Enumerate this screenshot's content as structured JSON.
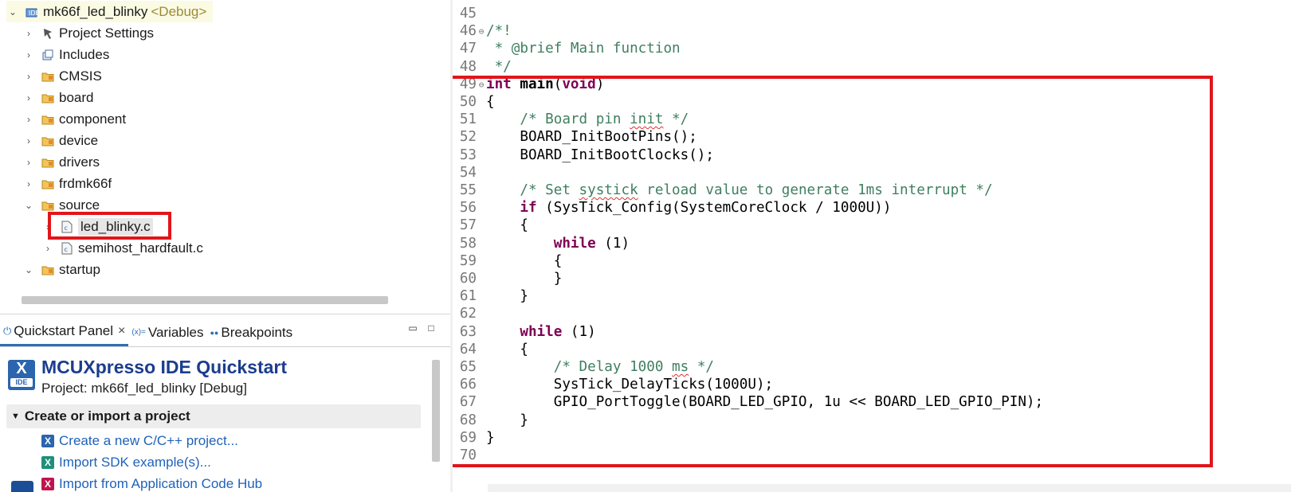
{
  "explorer": {
    "project": {
      "name": "mk66f_led_blinky",
      "decoration": "<Debug>"
    },
    "items": [
      {
        "label": "Project Settings",
        "icon": "settings-icon",
        "expanded": false
      },
      {
        "label": "Includes",
        "icon": "includes-icon",
        "expanded": false
      },
      {
        "label": "CMSIS",
        "icon": "folder-icon",
        "expanded": false
      },
      {
        "label": "board",
        "icon": "folder-icon",
        "expanded": false
      },
      {
        "label": "component",
        "icon": "folder-icon",
        "expanded": false
      },
      {
        "label": "device",
        "icon": "folder-icon",
        "expanded": false
      },
      {
        "label": "drivers",
        "icon": "folder-icon",
        "expanded": false
      },
      {
        "label": "frdmk66f",
        "icon": "folder-icon",
        "expanded": false
      },
      {
        "label": "source",
        "icon": "folder-icon",
        "expanded": true
      },
      {
        "label": "led_blinky.c",
        "icon": "c-file-icon",
        "selected": true
      },
      {
        "label": "semihost_hardfault.c",
        "icon": "c-file-icon"
      },
      {
        "label": "startup",
        "icon": "folder-icon",
        "expanded": true
      }
    ]
  },
  "panel": {
    "tabs": [
      {
        "label": "Quickstart Panel",
        "icon": "power-icon",
        "active": true,
        "closable": true
      },
      {
        "label": "Variables",
        "icon": "variables-icon",
        "icon_text": "(x)="
      },
      {
        "label": "Breakpoints",
        "icon": "breakpoints-icon",
        "icon_text": "●●"
      }
    ],
    "minimize": "▭",
    "maximize": "□",
    "logo": {
      "mark": "X",
      "text": "IDE"
    },
    "title": "MCUXpresso IDE Quickstart",
    "subtitle": "Project: mk66f_led_blinky [Debug]",
    "section": "Create or import a project",
    "links": [
      {
        "label": "Create a new C/C++ project...",
        "icon": "new-project-icon",
        "color": "#2b65ad"
      },
      {
        "label": "Import SDK example(s)...",
        "icon": "import-sdk-icon",
        "color": "#1d8f7a"
      },
      {
        "label": "Import from Application Code Hub",
        "icon": "code-hub-icon",
        "color": "#c0134f"
      }
    ]
  },
  "editor": {
    "lines": [
      {
        "n": "45",
        "fold": "",
        "tokens": []
      },
      {
        "n": "46",
        "fold": "⊖",
        "tokens": [
          {
            "t": "/*!",
            "c": "cm"
          }
        ]
      },
      {
        "n": "47",
        "fold": "",
        "tokens": [
          {
            "t": " * @brief Main function",
            "c": "cm"
          }
        ]
      },
      {
        "n": "48",
        "fold": "",
        "tokens": [
          {
            "t": " */",
            "c": "cm"
          }
        ]
      },
      {
        "n": "49",
        "fold": "⊖",
        "tokens": [
          {
            "t": "int",
            "c": "kw"
          },
          {
            "t": " "
          },
          {
            "t": "main",
            "c": "fn"
          },
          {
            "t": "("
          },
          {
            "t": "void",
            "c": "kw"
          },
          {
            "t": ")"
          }
        ]
      },
      {
        "n": "50",
        "fold": "",
        "tokens": [
          {
            "t": "{"
          }
        ]
      },
      {
        "n": "51",
        "fold": "",
        "tokens": [
          {
            "t": "    /* Board pin ",
            "c": "cm"
          },
          {
            "t": "init",
            "c": "cm sq"
          },
          {
            "t": " */",
            "c": "cm"
          }
        ]
      },
      {
        "n": "52",
        "fold": "",
        "tokens": [
          {
            "t": "    BOARD_InitBootPins();"
          }
        ]
      },
      {
        "n": "53",
        "fold": "",
        "tokens": [
          {
            "t": "    BOARD_InitBootClocks();"
          }
        ]
      },
      {
        "n": "54",
        "fold": "",
        "tokens": []
      },
      {
        "n": "55",
        "fold": "",
        "tokens": [
          {
            "t": "    /* Set ",
            "c": "cm"
          },
          {
            "t": "systick",
            "c": "cm sq"
          },
          {
            "t": " reload value to generate 1ms interrupt */",
            "c": "cm"
          }
        ]
      },
      {
        "n": "56",
        "fold": "",
        "tokens": [
          {
            "t": "    "
          },
          {
            "t": "if",
            "c": "kw"
          },
          {
            "t": " (SysTick_Config(SystemCoreClock / 1000U))"
          }
        ]
      },
      {
        "n": "57",
        "fold": "",
        "tokens": [
          {
            "t": "    {"
          }
        ]
      },
      {
        "n": "58",
        "fold": "",
        "tokens": [
          {
            "t": "        "
          },
          {
            "t": "while",
            "c": "kw"
          },
          {
            "t": " (1)"
          }
        ]
      },
      {
        "n": "59",
        "fold": "",
        "tokens": [
          {
            "t": "        {"
          }
        ]
      },
      {
        "n": "60",
        "fold": "",
        "tokens": [
          {
            "t": "        }"
          }
        ]
      },
      {
        "n": "61",
        "fold": "",
        "tokens": [
          {
            "t": "    }"
          }
        ]
      },
      {
        "n": "62",
        "fold": "",
        "tokens": []
      },
      {
        "n": "63",
        "fold": "",
        "tokens": [
          {
            "t": "    "
          },
          {
            "t": "while",
            "c": "kw"
          },
          {
            "t": " (1)"
          }
        ]
      },
      {
        "n": "64",
        "fold": "",
        "tokens": [
          {
            "t": "    {"
          }
        ]
      },
      {
        "n": "65",
        "fold": "",
        "tokens": [
          {
            "t": "        /* Delay 1000 ",
            "c": "cm"
          },
          {
            "t": "ms",
            "c": "cm sq"
          },
          {
            "t": " */",
            "c": "cm"
          }
        ]
      },
      {
        "n": "66",
        "fold": "",
        "tokens": [
          {
            "t": "        SysTick_DelayTicks(1000U);"
          }
        ]
      },
      {
        "n": "67",
        "fold": "",
        "tokens": [
          {
            "t": "        GPIO_PortToggle(BOARD_LED_GPIO, 1u << BOARD_LED_GPIO_PIN);"
          }
        ]
      },
      {
        "n": "68",
        "fold": "",
        "tokens": [
          {
            "t": "    }"
          }
        ]
      },
      {
        "n": "69",
        "fold": "",
        "tokens": [
          {
            "t": "}"
          }
        ]
      },
      {
        "n": "70",
        "fold": "",
        "tokens": []
      }
    ]
  },
  "highlight_color": "#e0161b"
}
